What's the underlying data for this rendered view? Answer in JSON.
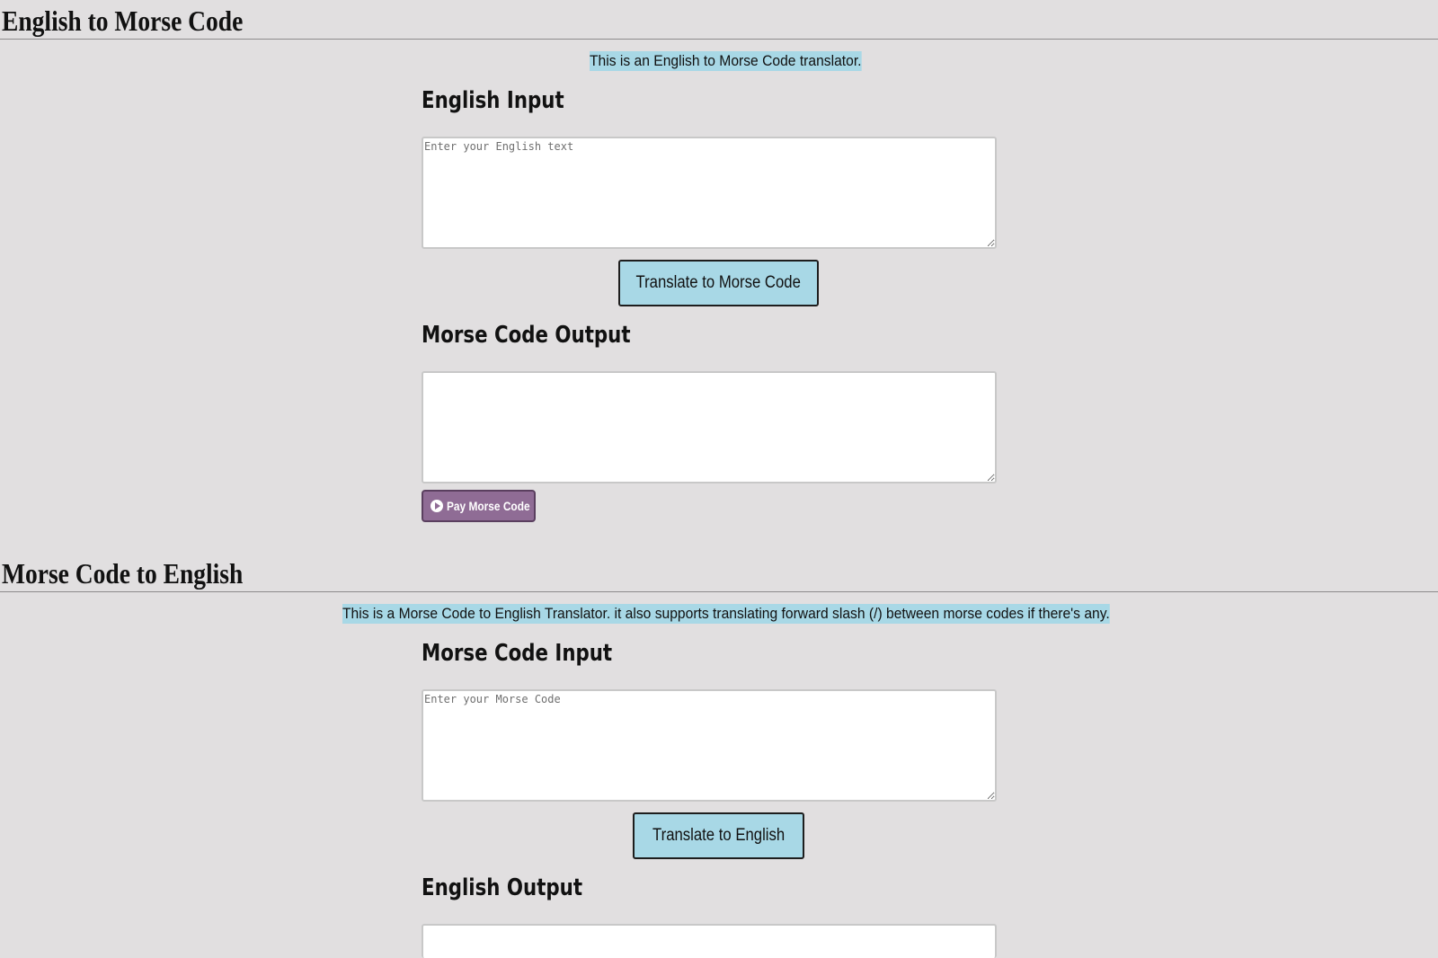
{
  "english_to_morse": {
    "title": "English to Morse Code",
    "description": "This is an English to Morse Code translator.",
    "input_label": "English Input",
    "input_placeholder": "Enter your English text",
    "input_value": "",
    "translate_button": "Translate to Morse Code",
    "output_label": "Morse Code Output",
    "output_value": "",
    "play_button": "Pay Morse Code",
    "play_icon": "play-circle-icon"
  },
  "morse_to_english": {
    "title": "Morse Code to English",
    "description": "This is a Morse Code to English Translator. it also supports translating forward slash (/) between morse codes if there's any.",
    "input_label": "Morse Code Input",
    "input_placeholder": "Enter your Morse Code",
    "input_value": "",
    "translate_button": "Translate to English",
    "output_label": "English Output",
    "output_value": ""
  },
  "colors": {
    "background": "#e1dfe0",
    "highlight": "#a8d8e6",
    "play_button": "#8f6c95"
  }
}
